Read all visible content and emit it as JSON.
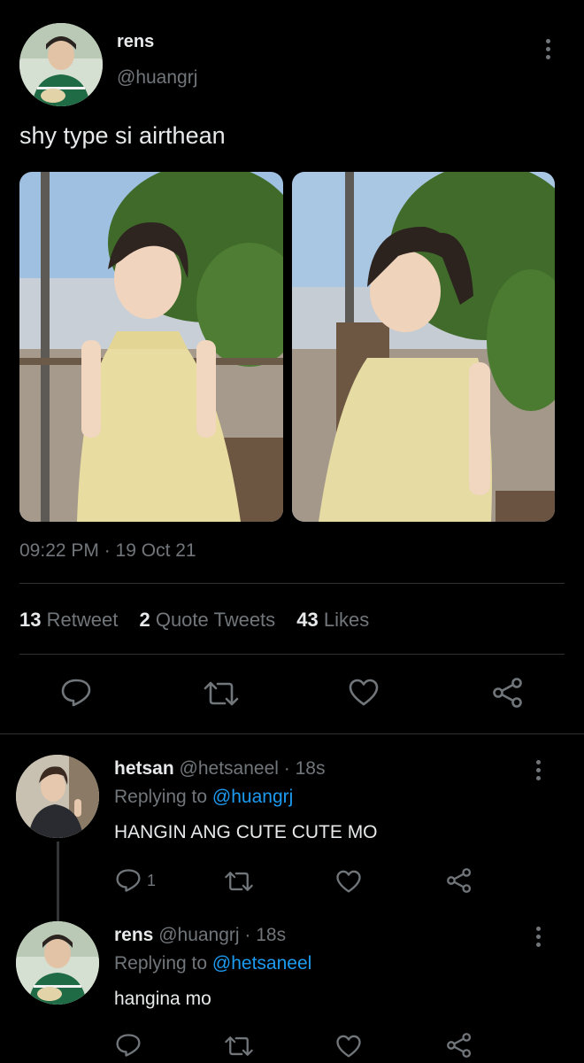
{
  "tweet": {
    "display_name": "rens",
    "handle": "@huangrj",
    "text": "shy type si airthean",
    "timestamp": "09:22 PM · 19 Oct 21",
    "stats": {
      "retweets_count": "13",
      "retweets_label": "Retweet",
      "quotes_count": "2",
      "quotes_label": "Quote Tweets",
      "likes_count": "43",
      "likes_label": "Likes"
    },
    "actions": [
      "reply-icon",
      "retweet-icon",
      "like-icon",
      "share-icon"
    ]
  },
  "replies": [
    {
      "display_name": "hetsan",
      "handle": "@hetsaneel",
      "time": "· 18s",
      "replying_prefix": "Replying to",
      "replying_to": "@huangrj",
      "text": "HANGIN ANG CUTE CUTE MO",
      "reply_count": "1"
    },
    {
      "display_name": "rens",
      "handle": "@huangrj",
      "time": "· 18s",
      "replying_prefix": "Replying to",
      "replying_to": "@hetsaneel",
      "text": "hangina mo",
      "reply_count": ""
    }
  ],
  "colors": {
    "background": "#000000",
    "text": "#e7e9ea",
    "muted": "#71767b",
    "link": "#1d9bf0",
    "divider": "#2f3336"
  }
}
